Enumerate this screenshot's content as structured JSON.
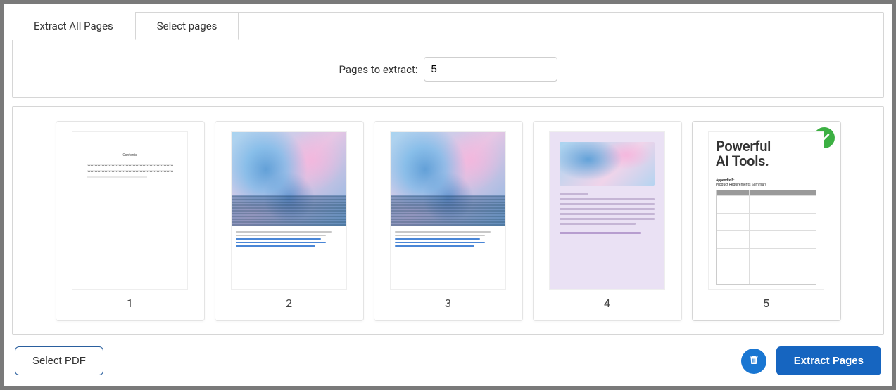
{
  "tabs": {
    "extract_all": "Extract All Pages",
    "select_pages": "Select pages",
    "active": "select_pages"
  },
  "form": {
    "pages_label": "Pages to extract:",
    "pages_value": "5"
  },
  "pages": [
    {
      "number": "1",
      "selected": false
    },
    {
      "number": "2",
      "selected": false
    },
    {
      "number": "3",
      "selected": false
    },
    {
      "number": "4",
      "selected": false
    },
    {
      "number": "5",
      "selected": true
    }
  ],
  "page5_preview": {
    "heading_line1": "Powerful",
    "heading_line2": "AI Tools.",
    "appendix_label": "Appendix E:",
    "appendix_title": "Product Requirements Summary"
  },
  "footer": {
    "select_pdf": "Select PDF",
    "extract_pages": "Extract Pages"
  },
  "icons": {
    "check": "check-icon",
    "trash": "trash-icon"
  }
}
